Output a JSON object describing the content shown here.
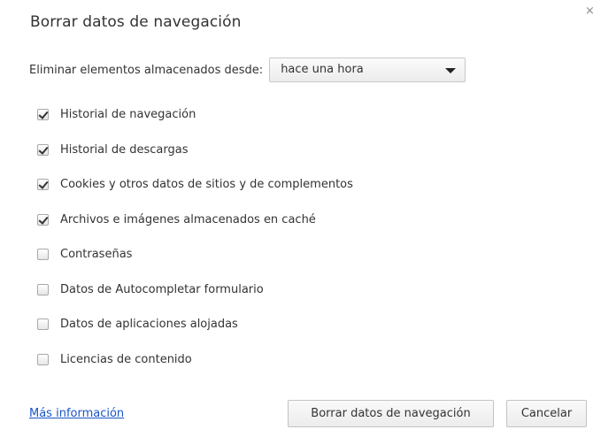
{
  "dialog": {
    "title": "Borrar datos de navegación",
    "close_glyph": "×"
  },
  "period": {
    "label": "Eliminar elementos almacenados desde:",
    "selected": "hace una hora"
  },
  "options": [
    {
      "label": "Historial de navegación",
      "checked": true
    },
    {
      "label": "Historial de descargas",
      "checked": true
    },
    {
      "label": "Cookies y otros datos de sitios y de complementos",
      "checked": true
    },
    {
      "label": "Archivos e imágenes almacenados en caché",
      "checked": true
    },
    {
      "label": "Contraseñas",
      "checked": false
    },
    {
      "label": "Datos de Autocompletar formulario",
      "checked": false
    },
    {
      "label": "Datos de aplicaciones alojadas",
      "checked": false
    },
    {
      "label": "Licencias de contenido",
      "checked": false
    }
  ],
  "footer": {
    "more_info_link": "Más información",
    "clear_button": "Borrar datos de navegación",
    "cancel_button": "Cancelar"
  },
  "colors": {
    "link": "#1a55c9",
    "text": "#333333"
  }
}
